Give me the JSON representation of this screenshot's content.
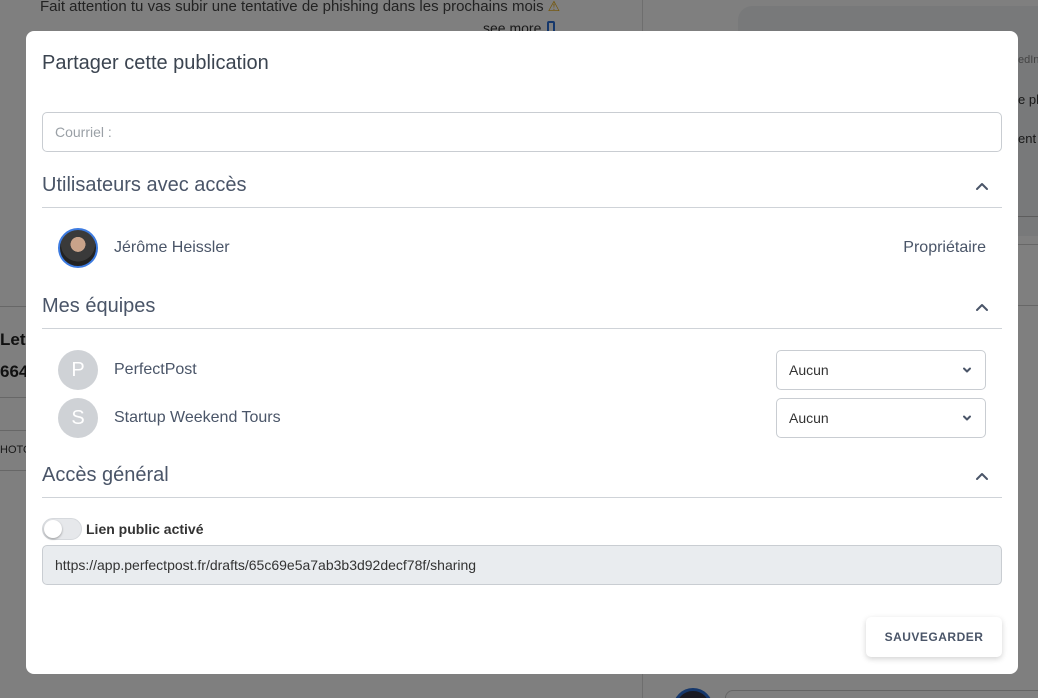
{
  "background": {
    "post_text": "Fait attention tu vas subir une tentative de phishing dans les prochains mois",
    "see_more": "see more",
    "frag_let": "Let",
    "frag_num": "664",
    "frag_hoto": "HOTO",
    "frag_edin": "edIn",
    "frag_phi": "e phi",
    "frag_ent": "ent"
  },
  "modal": {
    "title": "Partager cette publication",
    "email_placeholder": "Courriel :",
    "sections": {
      "users": {
        "title": "Utilisateurs avec accès",
        "owner": {
          "name": "Jérôme Heissler",
          "role": "Propriétaire"
        }
      },
      "teams": {
        "title": "Mes équipes",
        "items": [
          {
            "initial": "P",
            "name": "PerfectPost",
            "access": "Aucun"
          },
          {
            "initial": "S",
            "name": "Startup Weekend Tours",
            "access": "Aucun"
          }
        ]
      },
      "general": {
        "title": "Accès général",
        "toggle_label": "Lien public activé",
        "toggle_on": false,
        "link": "https://app.perfectpost.fr/drafts/65c69e5a7ab3b3d92decf78f/sharing"
      }
    },
    "save_label": "SAUVEGARDER"
  }
}
